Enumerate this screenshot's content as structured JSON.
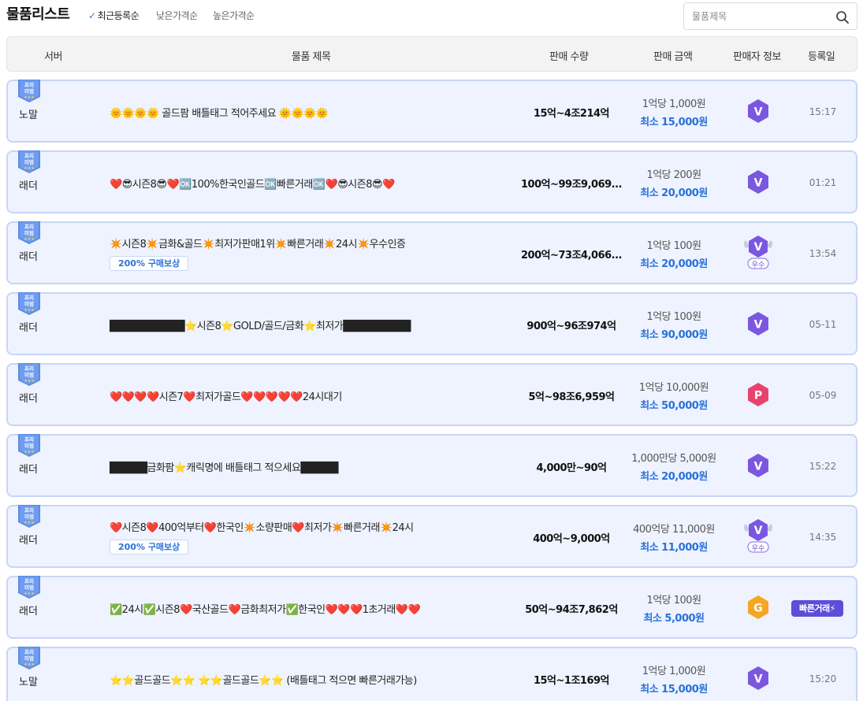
{
  "header": {
    "title": "물품리스트",
    "sorts": [
      {
        "label": "최근등록순",
        "active": true
      },
      {
        "label": "낮은가격순",
        "active": false
      },
      {
        "label": "높은가격순",
        "active": false
      }
    ],
    "search_placeholder": "물품제목",
    "search_icon": "search-icon"
  },
  "columns": {
    "server": "서버",
    "title": "물품 제목",
    "qty": "판매 수량",
    "price": "판매 금액",
    "seller": "판매자 정보",
    "date": "등록일"
  },
  "badge_label": "프리미엄",
  "rows": [
    {
      "server": "노말",
      "title": "🌞🌞🌞🌞 골드팜 배틀태그 적어주세요 🌞🌞🌞🌞",
      "tag": "",
      "qty": "15억~4조214억",
      "unit": "1억당 1,000원",
      "min": "최소 15,000원",
      "seller": "V",
      "seller_color": "#7b57e0",
      "tier": "",
      "date": "15:17"
    },
    {
      "server": "래더",
      "title": "❤️😎시즌8😎❤️🆗100%한국인골드🆗빠른거래🆗❤️😎시즌8😎❤️",
      "tag": "",
      "qty": "100억~99조9,069...",
      "unit": "1억당 200원",
      "min": "최소 20,000원",
      "seller": "V",
      "seller_color": "#7b57e0",
      "tier": "",
      "date": "01:21"
    },
    {
      "server": "래더",
      "title": "✴️시즌8✴️금화&골드✴️최저가판매1위✴️빠른거래✴️24시✴️우수인증",
      "tag": "200% 구매보상",
      "qty": "200억~73조4,066...",
      "unit": "1억당 100원",
      "min": "최소 20,000원",
      "seller": "V",
      "seller_color": "#7b57e0",
      "tier": "우수",
      "date": "13:54"
    },
    {
      "server": "래더",
      "title": "██████████⭐시즌8⭐GOLD/골드/금화⭐최저가█████████",
      "tag": "",
      "qty": "900억~96조974억",
      "unit": "1억당 100원",
      "min": "최소 90,000원",
      "seller": "V",
      "seller_color": "#7b57e0",
      "tier": "",
      "date": "05-11"
    },
    {
      "server": "래더",
      "title": "❤️❤️❤️❤️시즌7❤️최저가골드❤️❤️❤️❤️❤️24시대기",
      "tag": "",
      "qty": "5억~98조6,959억",
      "unit": "1억당 10,000원",
      "min": "최소 50,000원",
      "seller": "P",
      "seller_color": "#e8436e",
      "tier": "",
      "date": "05-09"
    },
    {
      "server": "래더",
      "title": "█████금화팜⭐캐릭명에 배틀태그 적으세요█████",
      "tag": "",
      "qty": "4,000만~90억",
      "unit": "1,000만당 5,000원",
      "min": "최소 20,000원",
      "seller": "V",
      "seller_color": "#7b57e0",
      "tier": "",
      "date": "15:22"
    },
    {
      "server": "래더",
      "title": "❤️시즌8❤️400억부터❤️한국인✴️소량판매❤️최저가✴️빠른거래✴️24시",
      "tag": "200% 구매보상",
      "qty": "400억~9,000억",
      "unit": "400억당 11,000원",
      "min": "최소 11,000원",
      "seller": "V",
      "seller_color": "#7b57e0",
      "tier": "우수",
      "date": "14:35"
    },
    {
      "server": "래더",
      "title": "✅24시✅시즌8❤️국산골드❤️금화최저가✅한국인❤️❤️❤️1초거래❤️❤️",
      "tag": "",
      "qty": "50억~94조7,862억",
      "unit": "1억당 100원",
      "min": "최소 5,000원",
      "seller": "G",
      "seller_color": "#f5a623",
      "tier": "",
      "date": "빠른거래⚡"
    },
    {
      "server": "노말",
      "title": "⭐⭐골드골드⭐⭐ ⭐⭐골드골드⭐⭐ (배틀태그 적으면 빠른거래가능)",
      "tag": "",
      "qty": "15억~1조169억",
      "unit": "1억당 1,000원",
      "min": "최소 15,000원",
      "seller": "V",
      "seller_color": "#7b57e0",
      "tier": "",
      "date": "15:20"
    }
  ]
}
